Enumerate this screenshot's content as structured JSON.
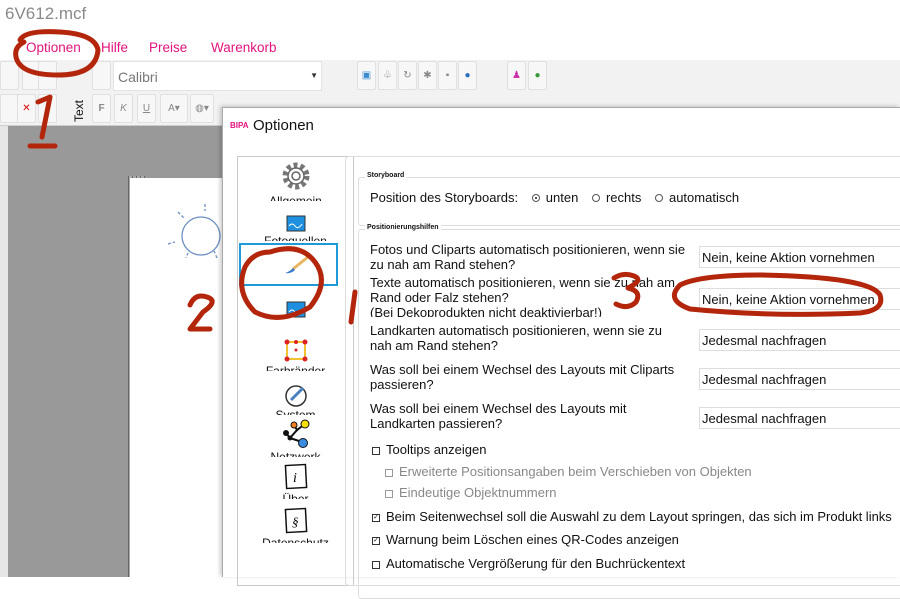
{
  "window": {
    "title": "6V612.mcf"
  },
  "menu": [
    {
      "label": "Optionen"
    },
    {
      "label": "Hilfe"
    },
    {
      "label": "Preise"
    },
    {
      "label": "Warenkorb"
    }
  ],
  "toolbar": {
    "font": "Calibri",
    "text_tab": "Text",
    "format_buttons": [
      "F",
      "K",
      "U"
    ]
  },
  "dialog": {
    "logo": "BIPA",
    "title": "Optionen",
    "sidebar": [
      {
        "label": "Allgemein",
        "icon": "gear-icon"
      },
      {
        "label": "Fotoquellen",
        "icon": "photo-icon"
      },
      {
        "label": "",
        "icon": "brush-icon",
        "selected": true
      },
      {
        "label": "",
        "icon": "photo-icon"
      },
      {
        "label": "Farbränder",
        "icon": "frame-icon"
      },
      {
        "label": "System",
        "icon": "system-icon"
      },
      {
        "label": "Netzwerk",
        "icon": "network-icon"
      },
      {
        "label": "Über",
        "icon": "info-icon"
      },
      {
        "label": "Datenschutz",
        "icon": "paragraph-icon"
      }
    ],
    "storyboard": {
      "group_label": "Storyboard",
      "label": "Position des Storyboards:",
      "options": [
        {
          "label": "unten",
          "selected": true
        },
        {
          "label": "rechts",
          "selected": false
        },
        {
          "label": "automatisch",
          "selected": false
        }
      ]
    },
    "positioning": {
      "group_label": "Positionierungshilfen",
      "rows": [
        {
          "q1": "Fotos und Cliparts automatisch positionieren, wenn sie",
          "q2": "zu nah am Rand stehen?",
          "q3": "",
          "value": "Nein, keine Aktion vornehmen"
        },
        {
          "q1": "Texte automatisch positionieren, wenn sie zu nah am",
          "q2": "Rand oder Falz stehen?",
          "q3": "(Bei Dekoprodukten nicht deaktivierbar!)",
          "value": "Nein, keine Aktion vornehmen"
        },
        {
          "q1": "Landkarten automatisch positionieren, wenn sie zu",
          "q2": "nah am Rand stehen?",
          "q3": "",
          "value": "Jedesmal nachfragen"
        },
        {
          "q1": "Was soll bei einem Wechsel des Layouts mit Cliparts",
          "q2": "passieren?",
          "q3": "",
          "value": "Jedesmal nachfragen"
        },
        {
          "q1": "Was soll bei einem Wechsel des Layouts mit",
          "q2": "Landkarten passieren?",
          "q3": "",
          "value": "Jedesmal nachfragen"
        }
      ],
      "checkboxes": [
        {
          "label": "Tooltips anzeigen",
          "checked": false,
          "disabled": false
        },
        {
          "label": "Erweiterte Positionsangaben beim Verschieben von Objekten",
          "checked": false,
          "disabled": true
        },
        {
          "label": "Eindeutige Objektnummern",
          "checked": false,
          "disabled": true
        },
        {
          "label": "Beim Seitenwechsel soll die Auswahl zu dem Layout springen, das sich im Produkt links",
          "checked": true,
          "disabled": false
        },
        {
          "label": "Warnung beim Löschen eines QR-Codes anzeigen",
          "checked": true,
          "disabled": false
        },
        {
          "label": "Automatische Vergrößerung für den Buchrückentext",
          "checked": false,
          "disabled": false
        }
      ]
    }
  },
  "annotations": [
    "1",
    "2",
    "3"
  ],
  "colors": {
    "brand": "#e2137e",
    "selection": "#1e9bd7",
    "annotation": "#b3260c"
  }
}
